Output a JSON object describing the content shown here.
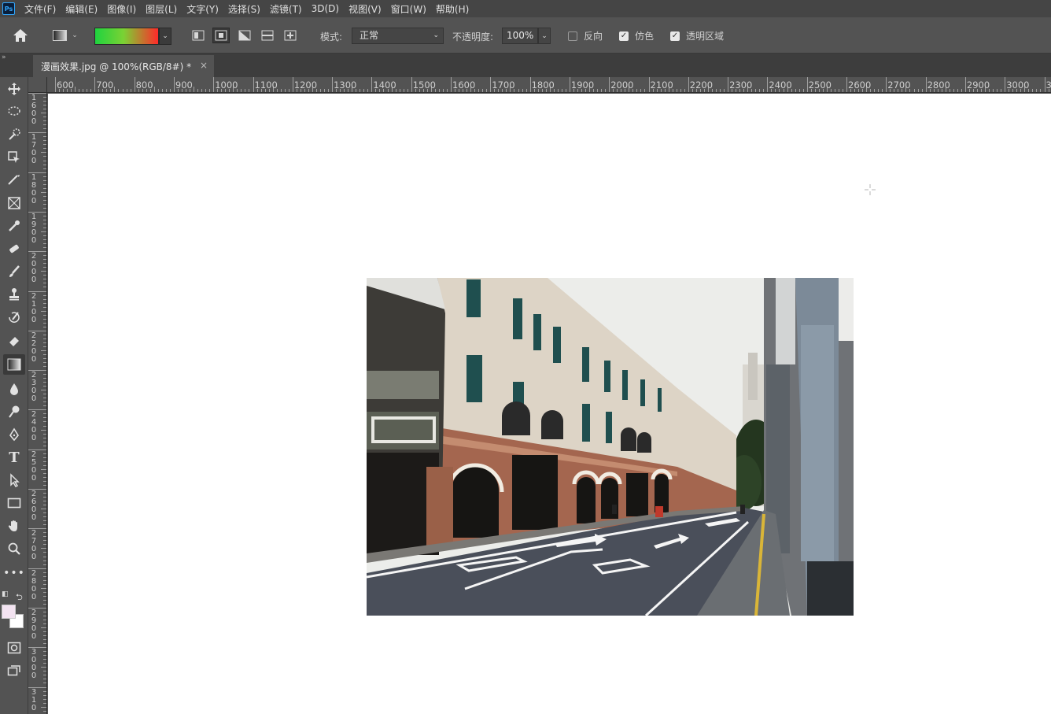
{
  "app": {
    "logo_text": "Ps"
  },
  "menu": [
    "文件(F)",
    "编辑(E)",
    "图像(I)",
    "图层(L)",
    "文字(Y)",
    "选择(S)",
    "滤镜(T)",
    "3D(D)",
    "视图(V)",
    "窗口(W)",
    "帮助(H)"
  ],
  "options": {
    "gradient_colors": {
      "start": "#1fd33f",
      "end": "#ff2a2a"
    },
    "mode_label": "模式:",
    "mode_value": "正常",
    "opacity_label": "不透明度:",
    "opacity_value": "100%",
    "reverse_label": "反向",
    "reverse_checked": false,
    "dither_label": "仿色",
    "dither_checked": true,
    "transparency_label": "透明区域",
    "transparency_checked": true
  },
  "document": {
    "tab_title": "漫画效果.jpg @ 100%(RGB/8#) *",
    "close_symbol": "×"
  },
  "rulers": {
    "horizontal": [
      "600",
      "700",
      "800",
      "900",
      "1000",
      "1100",
      "1200",
      "1300",
      "1400",
      "1500",
      "1600",
      "1700",
      "1800",
      "1900",
      "2000",
      "2100",
      "2200",
      "2300",
      "2400",
      "2500",
      "2600",
      "2700",
      "2800",
      "2900",
      "3000",
      "3"
    ],
    "vertical": [
      "1\n6\n0\n0",
      "1\n7\n0\n0",
      "1\n8\n0\n0",
      "1\n9\n0\n0",
      "2\n0\n0\n0",
      "2\n1\n0\n0",
      "2\n2\n0\n0",
      "2\n3\n0\n0",
      "2\n4\n0\n0",
      "2\n5\n0\n0",
      "2\n6\n0\n0",
      "2\n7\n0\n0",
      "2\n8\n0\n0",
      "2\n9\n0\n0",
      "3\n0\n0\n0",
      "3\n1\n0"
    ]
  },
  "toolbar": {
    "tools": [
      "move-tool",
      "lasso-tool",
      "quick-selection-tool",
      "crop-tool",
      "eyedropper-tool",
      "frame-tool",
      "spot-healing-tool",
      "eraser-tool",
      "brush-tool",
      "clone-stamp-tool",
      "history-brush-tool",
      "paint-bucket-tool",
      "gradient-tool",
      "blur-tool",
      "dodge-tool",
      "pen-tool",
      "type-tool",
      "path-selection-tool",
      "rectangle-tool",
      "hand-tool",
      "zoom-tool",
      "more-tools"
    ],
    "active_tool": "gradient-tool",
    "foreground_color": "#f3e3f1",
    "background_color": "#ffffff"
  },
  "canvas": {
    "background": "#ffffff"
  }
}
